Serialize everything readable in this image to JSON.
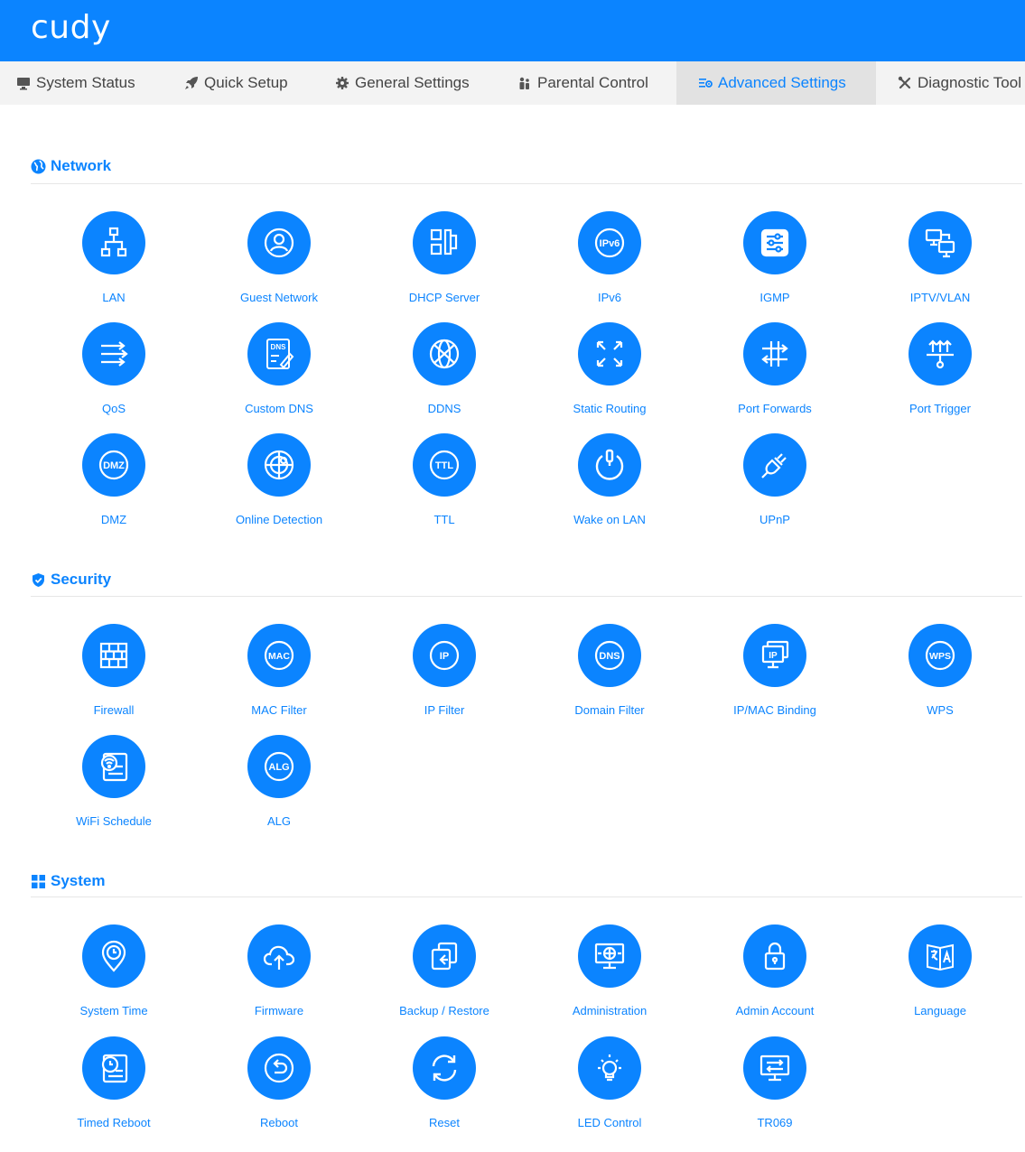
{
  "brand": {
    "logo": "cudy",
    "color": "#0b84ff"
  },
  "nav": {
    "tabs": [
      {
        "label": "System Status",
        "icon": "monitor-icon",
        "active": false
      },
      {
        "label": "Quick Setup",
        "icon": "rocket-icon",
        "active": false
      },
      {
        "label": "General Settings",
        "icon": "gear-icon",
        "active": false
      },
      {
        "label": "Parental Control",
        "icon": "family-icon",
        "active": false
      },
      {
        "label": "Advanced Settings",
        "icon": "sliders-icon",
        "active": true
      },
      {
        "label": "Diagnostic Tool",
        "icon": "tools-icon",
        "active": false
      }
    ]
  },
  "sections": {
    "network": {
      "title": "Network",
      "icon": "globe-icon",
      "items": [
        {
          "label": "LAN",
          "icon": "lan-icon"
        },
        {
          "label": "Guest Network",
          "icon": "guest-user-icon"
        },
        {
          "label": "DHCP Server",
          "icon": "dhcp-icon"
        },
        {
          "label": "IPv6",
          "icon": "ipv6-icon",
          "badge": "IPv6"
        },
        {
          "label": "IGMP",
          "icon": "igmp-icon"
        },
        {
          "label": "IPTV/VLAN",
          "icon": "iptv-icon"
        },
        {
          "label": "QoS",
          "icon": "qos-arrows-icon"
        },
        {
          "label": "Custom DNS",
          "icon": "custom-dns-icon",
          "badge": "DNS"
        },
        {
          "label": "DDNS",
          "icon": "ddns-icon"
        },
        {
          "label": "Static Routing",
          "icon": "static-routing-icon"
        },
        {
          "label": "Port Forwards",
          "icon": "port-forwards-icon"
        },
        {
          "label": "Port Trigger",
          "icon": "port-trigger-icon"
        },
        {
          "label": "DMZ",
          "icon": "dmz-icon",
          "badge": "DMZ"
        },
        {
          "label": "Online Detection",
          "icon": "online-detection-icon"
        },
        {
          "label": "TTL",
          "icon": "ttl-icon",
          "badge": "TTL"
        },
        {
          "label": "Wake on LAN",
          "icon": "power-icon"
        },
        {
          "label": "UPnP",
          "icon": "plug-icon"
        }
      ]
    },
    "security": {
      "title": "Security",
      "icon": "shield-icon",
      "items": [
        {
          "label": "Firewall",
          "icon": "firewall-icon"
        },
        {
          "label": "MAC Filter",
          "icon": "mac-icon",
          "badge": "MAC"
        },
        {
          "label": "IP Filter",
          "icon": "ip-icon",
          "badge": "IP"
        },
        {
          "label": "Domain Filter",
          "icon": "dns-icon",
          "badge": "DNS"
        },
        {
          "label": "IP/MAC Binding",
          "icon": "binding-icon",
          "badge": "IP"
        },
        {
          "label": "WPS",
          "icon": "wps-icon",
          "badge": "WPS"
        },
        {
          "label": "WiFi Schedule",
          "icon": "wifi-schedule-icon"
        },
        {
          "label": "ALG",
          "icon": "alg-icon",
          "badge": "ALG"
        }
      ]
    },
    "system": {
      "title": "System",
      "icon": "grid-icon",
      "items": [
        {
          "label": "System Time",
          "icon": "clock-pin-icon"
        },
        {
          "label": "Firmware",
          "icon": "cloud-upload-icon"
        },
        {
          "label": "Backup / Restore",
          "icon": "backup-icon"
        },
        {
          "label": "Administration",
          "icon": "admin-monitor-icon"
        },
        {
          "label": "Admin Account",
          "icon": "lock-icon"
        },
        {
          "label": "Language",
          "icon": "language-icon"
        },
        {
          "label": "Timed Reboot",
          "icon": "timed-reboot-icon"
        },
        {
          "label": "Reboot",
          "icon": "reboot-icon"
        },
        {
          "label": "Reset",
          "icon": "reset-icon"
        },
        {
          "label": "LED Control",
          "icon": "bulb-icon"
        },
        {
          "label": "TR069",
          "icon": "tr069-icon"
        }
      ]
    }
  }
}
